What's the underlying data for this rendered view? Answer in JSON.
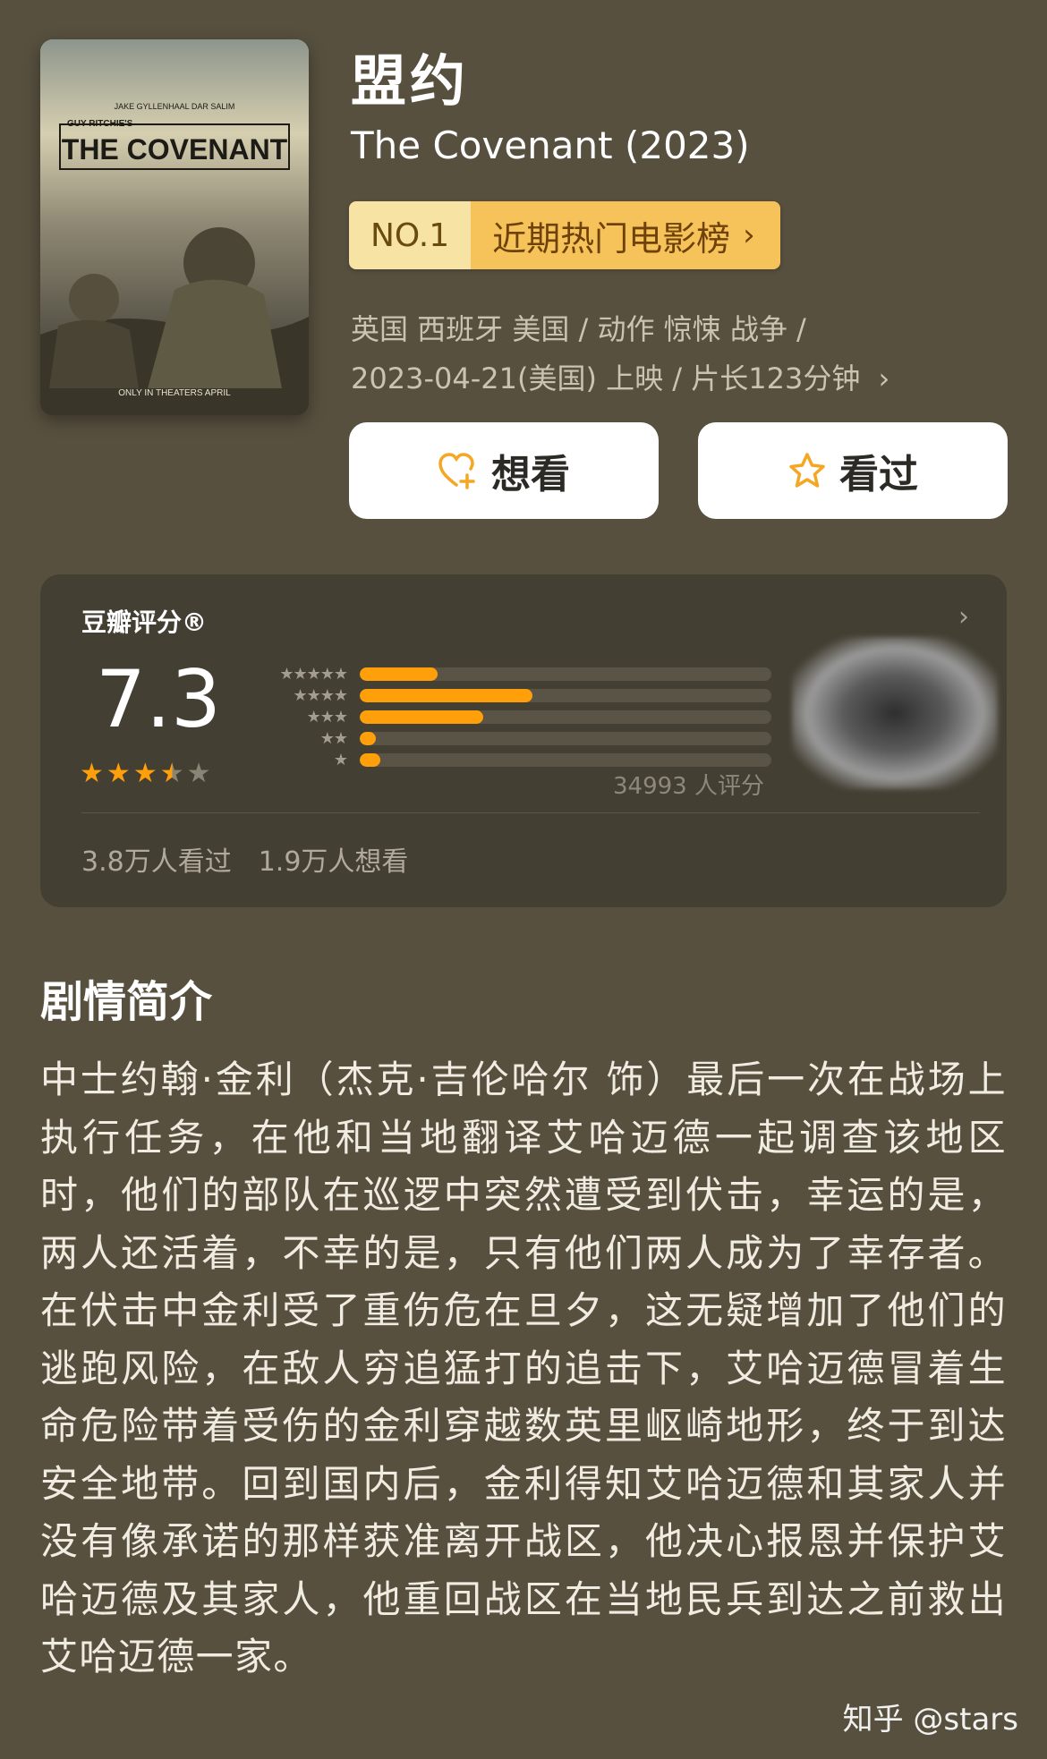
{
  "movie": {
    "title_cn": "盟约",
    "title_en": "The Covenant (2023)",
    "poster": {
      "actors": "JAKE GYLLENHAAL      DAR SALIM",
      "subtitle": "GUY RITCHIE'S",
      "title": "THE COVENANT",
      "footer": "ONLY IN THEATERS APRIL"
    },
    "rank": {
      "no": "NO.1",
      "list": "近期热门电影榜"
    },
    "meta_line1": "英国 西班牙 美国 / 动作 惊悚 战争 /",
    "meta_line2": "2023-04-21(美国) 上映 / 片长123分钟"
  },
  "actions": {
    "want_label": "想看",
    "seen_label": "看过"
  },
  "rating": {
    "title": "豆瓣评分®",
    "score": "7.3",
    "stars_value": 3.5,
    "distribution": [
      {
        "stars": 5,
        "percent": 19
      },
      {
        "stars": 4,
        "percent": 42
      },
      {
        "stars": 3,
        "percent": 30
      },
      {
        "stars": 2,
        "percent": 4
      },
      {
        "stars": 1,
        "percent": 5
      }
    ],
    "count_text": "34993 人评分",
    "watched_text": "3.8万人看过",
    "want_text": "1.9万人想看"
  },
  "synopsis": {
    "title": "剧情简介",
    "text": "中士约翰·金利（杰克·吉伦哈尔 饰）最后一次在战场上执行任务，在他和当地翻译艾哈迈德一起调查该地区时，他们的部队在巡逻中突然遭受到伏击，幸运的是，两人还活着，不幸的是，只有他们两人成为了幸存者。在伏击中金利受了重伤危在旦夕，这无疑增加了他们的逃跑风险，在敌人穷追猛打的追击下，艾哈迈德冒着生命危险带着受伤的金利穿越数英里岖崎地形，终于到达安全地带。回到国内后，金利得知艾哈迈德和其家人并没有像承诺的那样获准离开战区，他决心报恩并保护艾哈迈德及其家人，他重回战区在当地民兵到达之前救出艾哈迈德一家。"
  },
  "watermark": "知乎 @stars",
  "colors": {
    "background": "#57503f",
    "card": "#443f33",
    "accent_orange": "#ff9f0a",
    "rank_light": "#f7e3a4",
    "rank_dark": "#f6c35a"
  }
}
